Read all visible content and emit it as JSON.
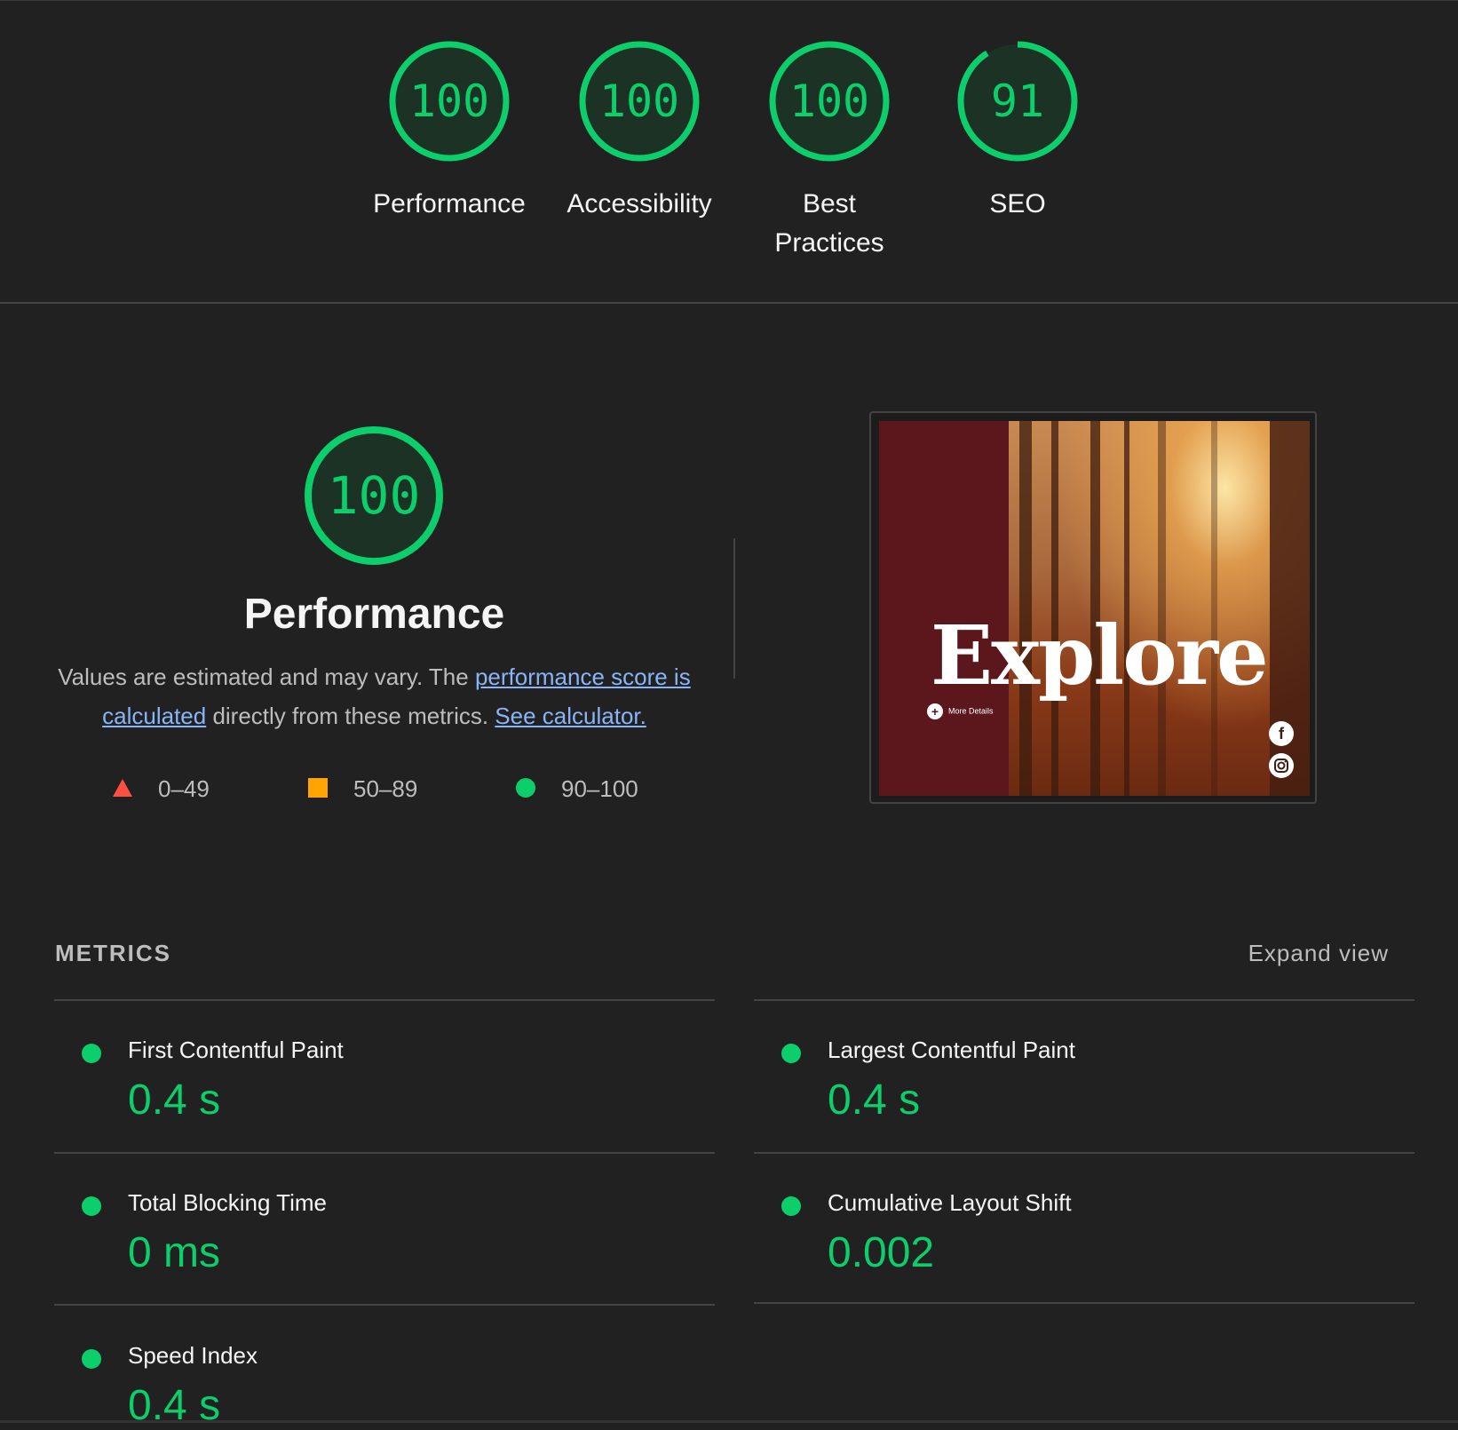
{
  "colors": {
    "background": "#212121",
    "pass_green": "#0cce6b",
    "average_orange": "#ffa400",
    "fail_red": "#ff4e42",
    "link": "#8ab4f8"
  },
  "gauges": [
    {
      "score": "100",
      "label": "Performance",
      "value": 100
    },
    {
      "score": "100",
      "label": "Accessibility",
      "value": 100
    },
    {
      "score": "100",
      "label_line1": "Best",
      "label_line2": "Practices",
      "value": 100
    },
    {
      "score": "91",
      "label": "SEO",
      "value": 91
    }
  ],
  "performance": {
    "score": "100",
    "score_value": 100,
    "title": "Performance",
    "desc_before": "Values are estimated and may vary. The ",
    "desc_link1": "performance score is calculated",
    "desc_middle": " directly from these metrics. ",
    "desc_link2": "See calculator.",
    "legend": {
      "fail": "0–49",
      "average": "50–89",
      "pass": "90–100"
    }
  },
  "screenshot": {
    "title": "Explore",
    "more_details": "More Details",
    "social_icons": [
      "facebook-icon",
      "instagram-icon"
    ]
  },
  "metrics": {
    "header": "METRICS",
    "expand_label": "Expand view",
    "items": [
      {
        "label": "First Contentful Paint",
        "value": "0.4 s"
      },
      {
        "label": "Largest Contentful Paint",
        "value": "0.4 s"
      },
      {
        "label": "Total Blocking Time",
        "value": "0 ms"
      },
      {
        "label": "Cumulative Layout Shift",
        "value": "0.002"
      },
      {
        "label": "Speed Index",
        "value": "0.4 s"
      }
    ]
  }
}
